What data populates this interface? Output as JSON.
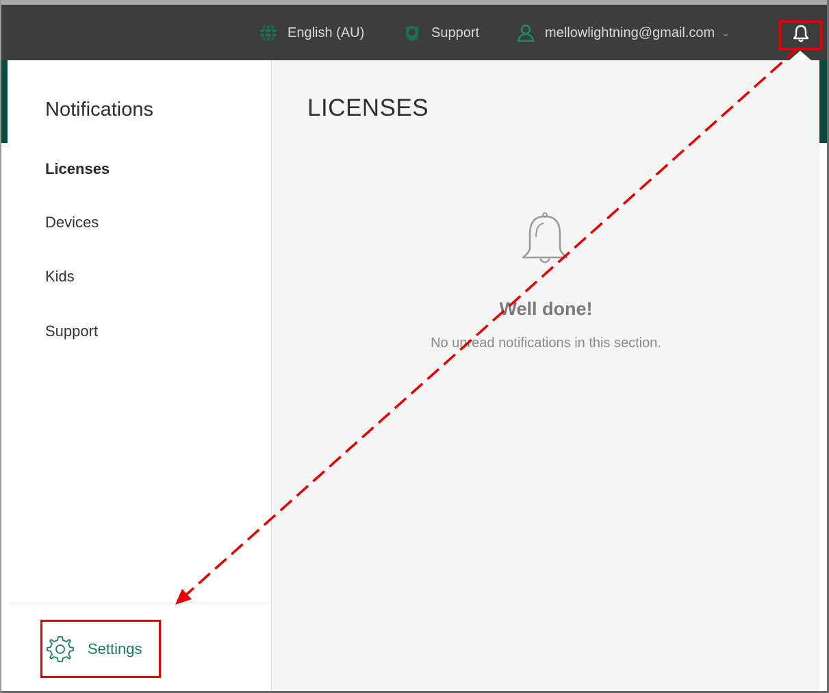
{
  "topbar": {
    "language_label": "English (AU)",
    "support_label": "Support",
    "user_email": "mellowlightning@gmail.com",
    "chevron": "⌄",
    "icons": {
      "language": "globe-icon",
      "support": "support-icon",
      "user": "user-icon",
      "notifications": "bell-icon"
    }
  },
  "sidebar": {
    "title": "Notifications",
    "items": [
      {
        "label": "Licenses",
        "active": true
      },
      {
        "label": "Devices",
        "active": false
      },
      {
        "label": "Kids",
        "active": false
      },
      {
        "label": "Support",
        "active": false
      }
    ],
    "settings_label": "Settings"
  },
  "content": {
    "section_title": "LICENSES",
    "empty_title": "Well done!",
    "empty_message": "No unread notifications in this section."
  },
  "colors": {
    "topbar_bg": "#3d3d3d",
    "accent_green": "#1d7a64",
    "highlight_red": "#e60000",
    "content_bg": "#f5f5f5"
  }
}
